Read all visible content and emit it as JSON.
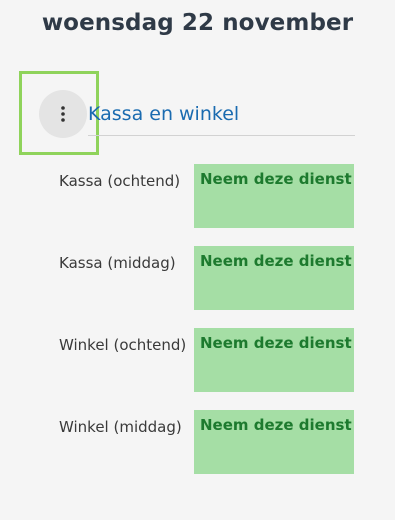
{
  "date_heading": "woensdag 22 november",
  "section": {
    "title": "Kassa en winkel",
    "menu_icon": "more-vertical-icon"
  },
  "shifts": [
    {
      "label": "Kassa (ochtend)",
      "action": "Neem deze dienst"
    },
    {
      "label": "Kassa (middag)",
      "action": "Neem deze dienst"
    },
    {
      "label": "Winkel (ochtend)",
      "action": "Neem deze dienst"
    },
    {
      "label": "Winkel (middag)",
      "action": "Neem deze dienst"
    }
  ],
  "colors": {
    "heading": "#2f3a47",
    "link": "#1a6bb0",
    "shift_button_bg": "#a5dea5",
    "shift_button_text": "#1d7a2e",
    "highlight": "#8fd35b"
  }
}
